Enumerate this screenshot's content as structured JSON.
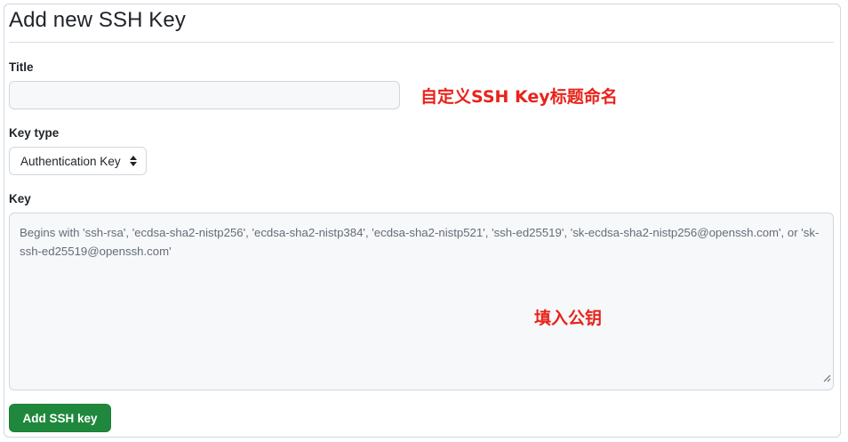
{
  "form": {
    "heading": "Add new SSH Key",
    "title_label": "Title",
    "title_value": "",
    "title_annotation": "自定义SSH Key标题命名",
    "key_type_label": "Key type",
    "key_type_selected": "Authentication Key",
    "key_label": "Key",
    "key_placeholder": "Begins with 'ssh-rsa', 'ecdsa-sha2-nistp256', 'ecdsa-sha2-nistp384', 'ecdsa-sha2-nistp521', 'ssh-ed25519', 'sk-ecdsa-sha2-nistp256@openssh.com', or 'sk-ssh-ed25519@openssh.com'",
    "key_annotation": "填入公钥",
    "submit_label": "Add SSH key"
  },
  "colors": {
    "primary_button": "#1f883d",
    "annotation": "#e8231b",
    "input_background": "#f6f8fa",
    "border": "#d0d7de"
  },
  "icons": {
    "select_caret": "chevron-up-down-icon",
    "resize": "resize-grip-icon"
  }
}
